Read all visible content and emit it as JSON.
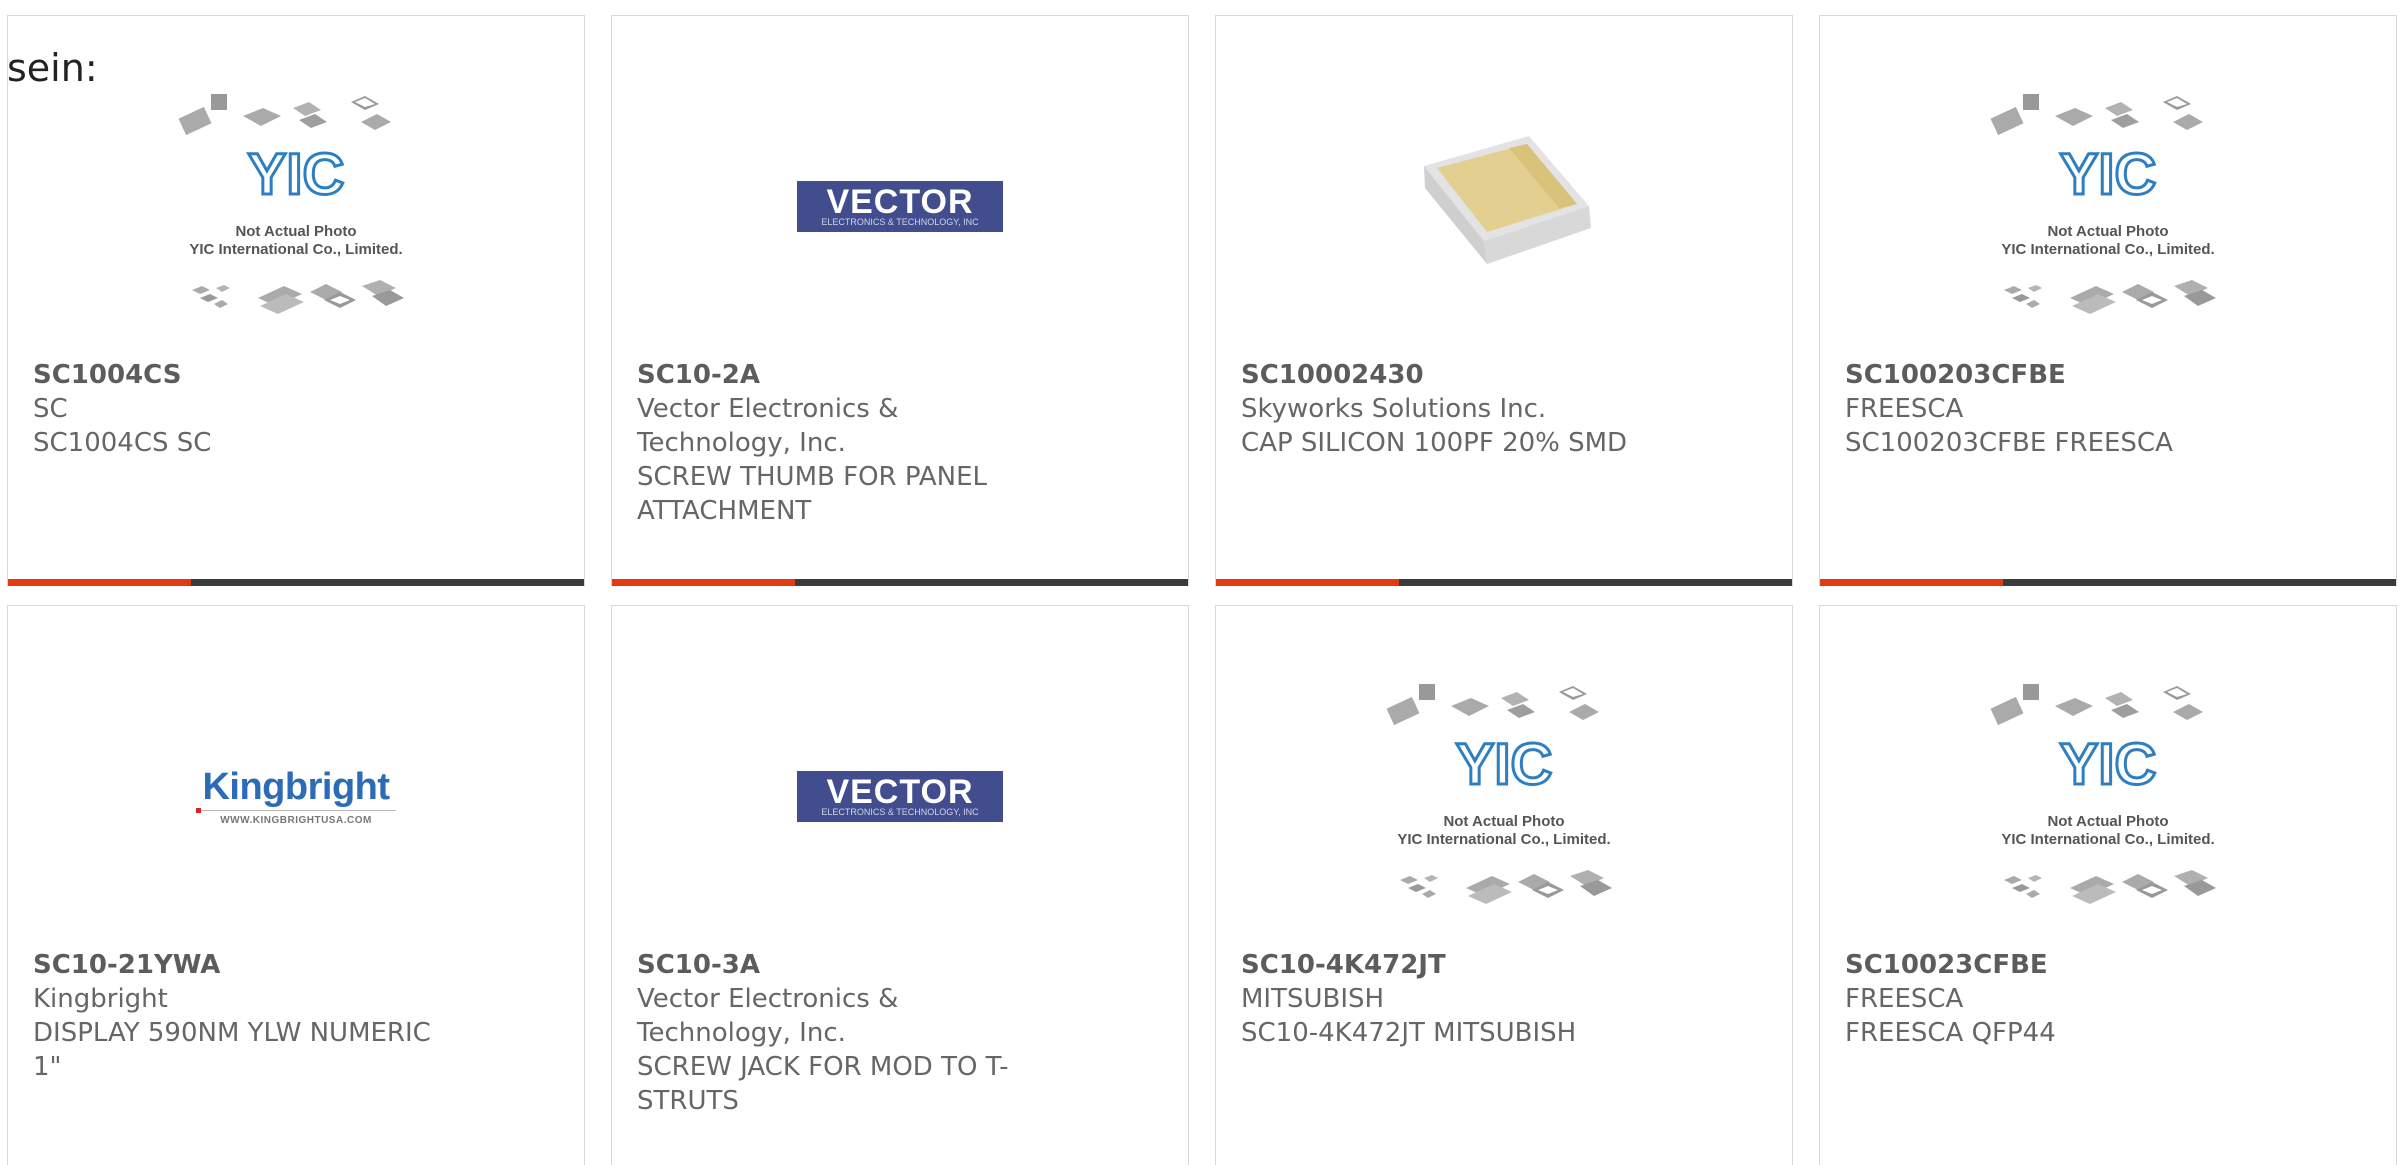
{
  "page": {
    "prefix_text": "sein:"
  },
  "colors": {
    "accent": "#e23b12",
    "bar": "#3b3b3b"
  },
  "placeholder": {
    "line1": "Not Actual Photo",
    "line2": "YIC International Co., Limited."
  },
  "products": [
    {
      "part": "SC1004CS",
      "maker": "SC",
      "desc": "SC1004CS SC",
      "image": "yic-placeholder-photo"
    },
    {
      "part": "SC10-2A",
      "maker": "Vector Electronics & Technology, Inc.",
      "desc": "SCREW THUMB FOR PANEL ATTACHMENT",
      "image": "vector-logo",
      "logo_main": "VECTOR",
      "logo_sub": "ELECTRONICS & TECHNOLOGY, INC"
    },
    {
      "part": "SC10002430",
      "maker": "Skyworks Solutions Inc.",
      "desc": "CAP SILICON 100PF 20% SMD",
      "image": "capacitor-photo"
    },
    {
      "part": "SC100203CFBE",
      "maker": "FREESCA",
      "desc": "SC100203CFBE FREESCA",
      "image": "yic-placeholder-photo"
    },
    {
      "part": "SC10-21YWA",
      "maker": "Kingbright",
      "desc": "DISPLAY 590NM YLW NUMERIC 1\"",
      "image": "kingbright-logo",
      "logo_main": "Kingbright",
      "logo_url": "WWW.KINGBRIGHTUSA.COM"
    },
    {
      "part": "SC10-3A",
      "maker": "Vector Electronics & Technology, Inc.",
      "desc": "SCREW JACK FOR MOD TO T-STRUTS",
      "image": "vector-logo",
      "logo_main": "VECTOR",
      "logo_sub": "ELECTRONICS & TECHNOLOGY, INC"
    },
    {
      "part": "SC10-4K472JT",
      "maker": "MITSUBISH",
      "desc": "SC10-4K472JT MITSUBISH",
      "image": "yic-placeholder-photo"
    },
    {
      "part": "SC10023CFBE",
      "maker": "FREESCA",
      "desc": "FREESCA QFP44",
      "image": "yic-placeholder-photo"
    }
  ]
}
